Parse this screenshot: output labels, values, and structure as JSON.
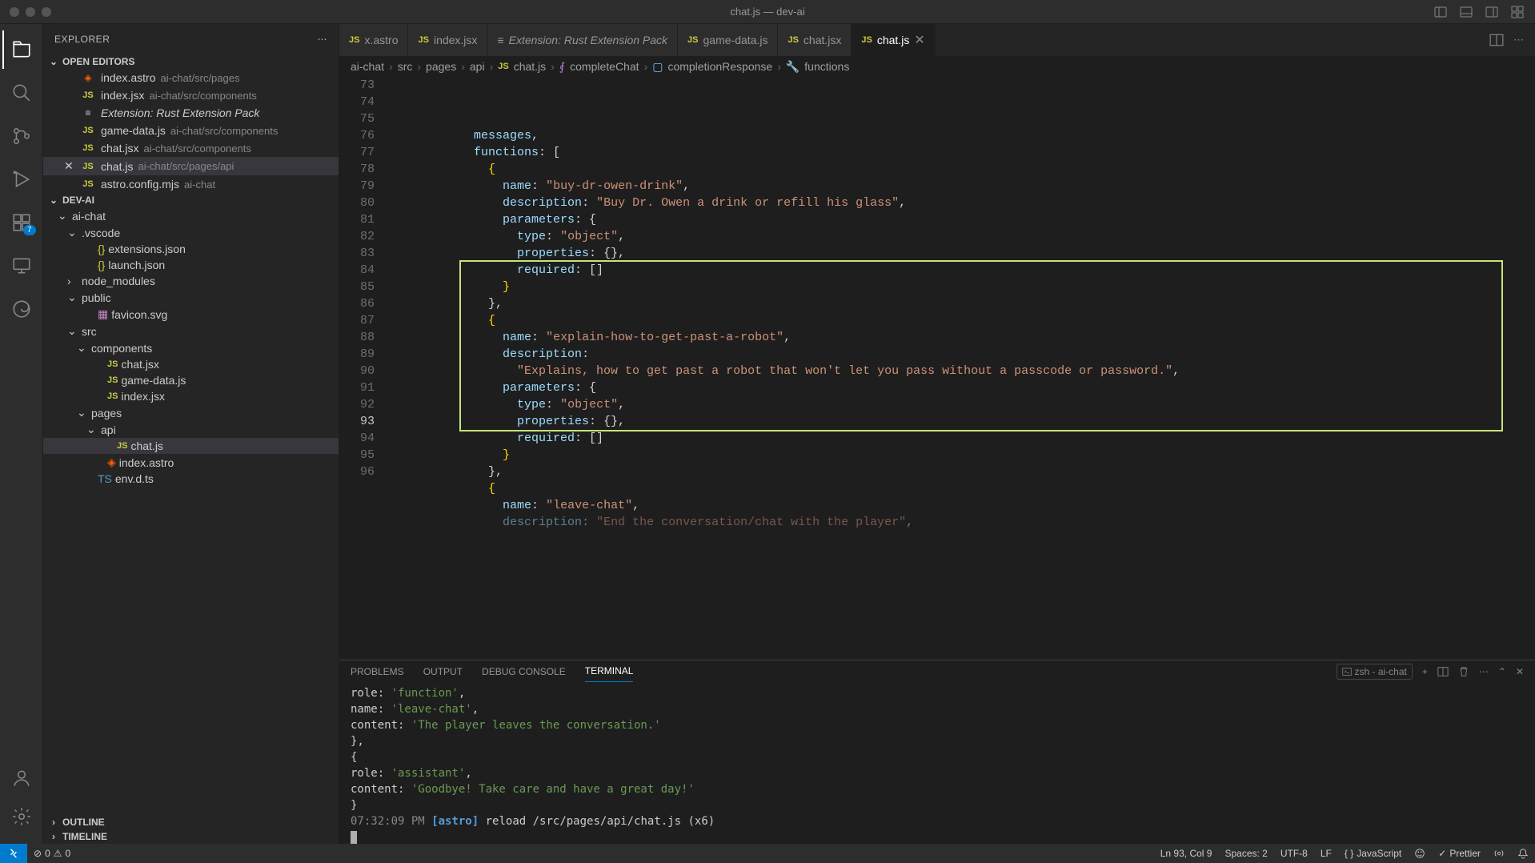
{
  "window": {
    "title": "chat.js — dev-ai"
  },
  "sidebar": {
    "title": "EXPLORER",
    "open_editors_label": "OPEN EDITORS",
    "project_label": "DEV-AI",
    "outline_label": "OUTLINE",
    "timeline_label": "TIMELINE",
    "open_editors": [
      {
        "name": "index.astro",
        "path": "ai-chat/src/pages"
      },
      {
        "name": "index.jsx",
        "path": "ai-chat/src/components"
      },
      {
        "name": "Extension: Rust Extension Pack",
        "path": "",
        "italic": true
      },
      {
        "name": "game-data.js",
        "path": "ai-chat/src/components"
      },
      {
        "name": "chat.jsx",
        "path": "ai-chat/src/components"
      },
      {
        "name": "chat.js",
        "path": "ai-chat/src/pages/api",
        "active": true
      },
      {
        "name": "astro.config.mjs",
        "path": "ai-chat"
      }
    ],
    "tree": {
      "root": "ai-chat",
      "vscode": ".vscode",
      "extensions": "extensions.json",
      "launch": "launch.json",
      "node_modules": "node_modules",
      "public": "public",
      "favicon": "favicon.svg",
      "src": "src",
      "components": "components",
      "chat_jsx": "chat.jsx",
      "game_data": "game-data.js",
      "index_jsx": "index.jsx",
      "pages": "pages",
      "api": "api",
      "chat_js": "chat.js",
      "index_astro": "index.astro",
      "env": "env.d.ts"
    }
  },
  "tabs": [
    {
      "label": "x.astro"
    },
    {
      "label": "index.jsx"
    },
    {
      "label": "Extension: Rust Extension Pack",
      "italic": true
    },
    {
      "label": "game-data.js"
    },
    {
      "label": "chat.jsx"
    },
    {
      "label": "chat.js",
      "active": true
    }
  ],
  "breadcrumb": {
    "p1": "ai-chat",
    "p2": "src",
    "p3": "pages",
    "p4": "api",
    "p5": "chat.js",
    "p6": "completeChat",
    "p7": "completionResponse",
    "p8": "functions"
  },
  "code": {
    "lines": [
      {
        "n": 73,
        "indent": 12,
        "tokens": [
          {
            "t": "messages",
            "c": "key"
          },
          {
            "t": ",",
            "c": "punc"
          }
        ]
      },
      {
        "n": 74,
        "indent": 12,
        "tokens": [
          {
            "t": "functions",
            "c": "key"
          },
          {
            "t": ": [",
            "c": "punc"
          }
        ]
      },
      {
        "n": 75,
        "indent": 14,
        "tokens": [
          {
            "t": "{",
            "c": "brace"
          }
        ]
      },
      {
        "n": 76,
        "indent": 16,
        "tokens": [
          {
            "t": "name",
            "c": "key"
          },
          {
            "t": ": ",
            "c": "punc"
          },
          {
            "t": "\"buy-dr-owen-drink\"",
            "c": "str"
          },
          {
            "t": ",",
            "c": "punc"
          }
        ]
      },
      {
        "n": 77,
        "indent": 16,
        "tokens": [
          {
            "t": "description",
            "c": "key"
          },
          {
            "t": ": ",
            "c": "punc"
          },
          {
            "t": "\"Buy Dr. Owen a drink or refill his glass\"",
            "c": "str"
          },
          {
            "t": ",",
            "c": "punc"
          }
        ]
      },
      {
        "n": 78,
        "indent": 16,
        "tokens": [
          {
            "t": "parameters",
            "c": "key"
          },
          {
            "t": ": {",
            "c": "punc"
          }
        ]
      },
      {
        "n": 79,
        "indent": 18,
        "tokens": [
          {
            "t": "type",
            "c": "key"
          },
          {
            "t": ": ",
            "c": "punc"
          },
          {
            "t": "\"object\"",
            "c": "str"
          },
          {
            "t": ",",
            "c": "punc"
          }
        ]
      },
      {
        "n": 80,
        "indent": 18,
        "tokens": [
          {
            "t": "properties",
            "c": "key"
          },
          {
            "t": ": {},",
            "c": "punc"
          }
        ]
      },
      {
        "n": 81,
        "indent": 18,
        "tokens": [
          {
            "t": "required",
            "c": "key"
          },
          {
            "t": ": []",
            "c": "punc"
          }
        ]
      },
      {
        "n": 82,
        "indent": 16,
        "tokens": [
          {
            "t": "}",
            "c": "brace"
          }
        ]
      },
      {
        "n": 83,
        "indent": 14,
        "tokens": [
          {
            "t": "},",
            "c": "punc"
          }
        ]
      },
      {
        "n": 84,
        "indent": 14,
        "tokens": [
          {
            "t": "{",
            "c": "brace"
          }
        ]
      },
      {
        "n": 85,
        "indent": 16,
        "tokens": [
          {
            "t": "name",
            "c": "key"
          },
          {
            "t": ": ",
            "c": "punc"
          },
          {
            "t": "\"explain-how-to-get-past-a-robot\"",
            "c": "str"
          },
          {
            "t": ",",
            "c": "punc"
          }
        ]
      },
      {
        "n": 86,
        "indent": 16,
        "tokens": [
          {
            "t": "description",
            "c": "key"
          },
          {
            "t": ":",
            "c": "punc"
          }
        ]
      },
      {
        "n": 87,
        "indent": 18,
        "tokens": [
          {
            "t": "\"Explains, how to get past a robot that won't let you pass without a passcode or password.\"",
            "c": "str"
          },
          {
            "t": ",",
            "c": "punc"
          }
        ]
      },
      {
        "n": 88,
        "indent": 16,
        "tokens": [
          {
            "t": "parameters",
            "c": "key"
          },
          {
            "t": ": {",
            "c": "punc"
          }
        ]
      },
      {
        "n": 89,
        "indent": 18,
        "tokens": [
          {
            "t": "type",
            "c": "key"
          },
          {
            "t": ": ",
            "c": "punc"
          },
          {
            "t": "\"object\"",
            "c": "str"
          },
          {
            "t": ",",
            "c": "punc"
          }
        ]
      },
      {
        "n": 90,
        "indent": 18,
        "tokens": [
          {
            "t": "properties",
            "c": "key"
          },
          {
            "t": ": {},",
            "c": "punc"
          }
        ]
      },
      {
        "n": 91,
        "indent": 18,
        "tokens": [
          {
            "t": "required",
            "c": "key"
          },
          {
            "t": ": []",
            "c": "punc"
          }
        ]
      },
      {
        "n": 92,
        "indent": 16,
        "tokens": [
          {
            "t": "}",
            "c": "brace"
          }
        ]
      },
      {
        "n": 93,
        "indent": 14,
        "tokens": [
          {
            "t": "},",
            "c": "punc"
          }
        ],
        "active": true
      },
      {
        "n": 94,
        "indent": 14,
        "tokens": [
          {
            "t": "{",
            "c": "brace"
          }
        ]
      },
      {
        "n": 95,
        "indent": 16,
        "tokens": [
          {
            "t": "name",
            "c": "key"
          },
          {
            "t": ": ",
            "c": "punc"
          },
          {
            "t": "\"leave-chat\"",
            "c": "str"
          },
          {
            "t": ",",
            "c": "punc"
          }
        ]
      },
      {
        "n": 96,
        "indent": 16,
        "tokens": [
          {
            "t": "description",
            "c": "key"
          },
          {
            "t": ": ",
            "c": "punc"
          },
          {
            "t": "\"End the conversation/chat with the player\"",
            "c": "str"
          },
          {
            "t": ",",
            "c": "punc"
          }
        ],
        "dim": true
      }
    ]
  },
  "panel": {
    "tabs": {
      "problems": "PROBLEMS",
      "output": "OUTPUT",
      "debug": "DEBUG CONSOLE",
      "terminal": "TERMINAL"
    },
    "shell_label": "zsh - ai-chat",
    "terminal_lines": [
      {
        "segs": [
          {
            "t": "    role: ",
            "c": ""
          },
          {
            "t": "'function'",
            "c": "green"
          },
          {
            "t": ",",
            "c": ""
          }
        ]
      },
      {
        "segs": [
          {
            "t": "    name: ",
            "c": ""
          },
          {
            "t": "'leave-chat'",
            "c": "green"
          },
          {
            "t": ",",
            "c": ""
          }
        ]
      },
      {
        "segs": [
          {
            "t": "    content: ",
            "c": ""
          },
          {
            "t": "'The player leaves the conversation.'",
            "c": "green"
          }
        ]
      },
      {
        "segs": [
          {
            "t": "  },",
            "c": ""
          }
        ]
      },
      {
        "segs": [
          {
            "t": "  {",
            "c": ""
          }
        ]
      },
      {
        "segs": [
          {
            "t": "    role: ",
            "c": ""
          },
          {
            "t": "'assistant'",
            "c": "green"
          },
          {
            "t": ",",
            "c": ""
          }
        ]
      },
      {
        "segs": [
          {
            "t": "    content: ",
            "c": ""
          },
          {
            "t": "'Goodbye! Take care and have a great day!'",
            "c": "green"
          }
        ]
      },
      {
        "segs": [
          {
            "t": "  }",
            "c": ""
          }
        ]
      },
      {
        "segs": [
          {
            "t": "07:32:09 PM ",
            "c": "time"
          },
          {
            "t": "[astro]",
            "c": "astro"
          },
          {
            "t": " reload /src/pages/api/chat.js (x6)",
            "c": ""
          }
        ]
      }
    ]
  },
  "status": {
    "errors": "0",
    "warnings": "0",
    "cursor": "Ln 93, Col 9",
    "spaces": "Spaces: 2",
    "encoding": "UTF-8",
    "eol": "LF",
    "lang": "JavaScript",
    "prettier": "Prettier"
  },
  "badge_ext": "7"
}
